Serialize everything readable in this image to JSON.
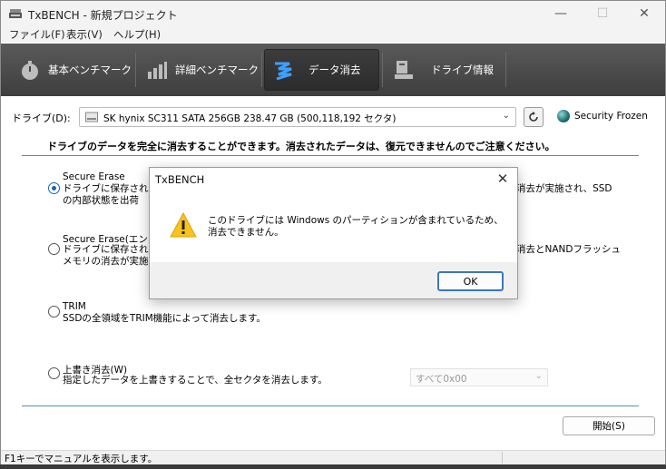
{
  "window": {
    "title": "TxBENCH - 新規プロジェクト"
  },
  "menu": {
    "items": [
      "ファイル(F)",
      "表示(V)",
      "ヘルプ(H)"
    ]
  },
  "toolbar": {
    "basic_label": "基本ベンチマーク",
    "detailed_label": "詳細ベンチマーク",
    "erase_label": "データ消去",
    "info_label": "ドライブ情報"
  },
  "drive": {
    "label": "ドライブ(D):",
    "selected": "SK hynix SC311 SATA 256GB  238.47 GB (500,118,192 セクタ)",
    "security_status": "Security Frozen"
  },
  "notice": "ドライブのデータを完全に消去することができます。消去されたデータは、復元できませんのでご注意ください。",
  "options": {
    "secure_erase": {
      "title": "Secure Erase",
      "desc_line1": "ドライブに保存されて",
      "desc_line2": "の内部状態を出荷",
      "tail_line1": "消去が実施され、SSD"
    },
    "secure_erase_enh": {
      "title": "Secure Erase(エン",
      "desc_line1": "ドライブに保存されて",
      "desc_line2": "メモリの消去が実施",
      "tail_line1": "消去とNANDフラッシュ"
    },
    "trim": {
      "title": "TRIM",
      "desc": "SSDの全領域をTRIM機能によって消去します。"
    },
    "overwrite": {
      "title": "上書き消去(W)",
      "desc": "指定したデータを上書きすることで、全セクタを消去します。",
      "pattern": "すべて0x00"
    }
  },
  "start_button": "開始(S)",
  "status": {
    "text": "F1キーでマニュアルを表示します。"
  },
  "dialog": {
    "title": "TxBENCH",
    "message": "このドライブには Windows のパーティションが含まれているため、消去できません。",
    "ok_label": "OK"
  }
}
